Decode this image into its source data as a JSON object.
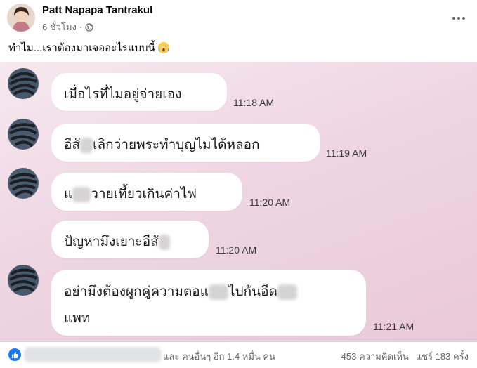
{
  "post": {
    "author": "Patt Napapa Tantrakul",
    "time": "6 ชั่วโมง",
    "audience_icon": "globe-icon",
    "caption": "ทำไม...เราต้องมาเจออะไรแบบนี้",
    "caption_emoji": "screaming-face-emoji"
  },
  "chat": {
    "messages": [
      {
        "text": "เมื่อไรที่ไมอยู่จ่ายเอง",
        "time": "11:18 AM"
      },
      {
        "text_before": "อีสั",
        "text_after": "เลิกว่ายพระทำบุญไมได้หลอก",
        "time": "11:19 AM"
      },
      {
        "text_before": "แ",
        "text_after": "วายเที้ยวเกินค่าไฟ",
        "time": "11:20 AM"
      },
      {
        "text_before": "ปัญหามึงเยาะอีสั",
        "time": "11:20 AM"
      },
      {
        "text_before": "อย่ามึงต้องผูกคู่ความตอแ",
        "text_middle": "ไปกันอีด",
        "line2": "แพท",
        "time": "11:21 AM"
      }
    ]
  },
  "footer": {
    "reactions_text": "และ คนอื่นๆ อีก 1.4 หมื่น คน",
    "comments": "453 ความคิดเห็น",
    "shares": "แชร์ 183 ครั้ง",
    "like_color": "#1877f2"
  }
}
